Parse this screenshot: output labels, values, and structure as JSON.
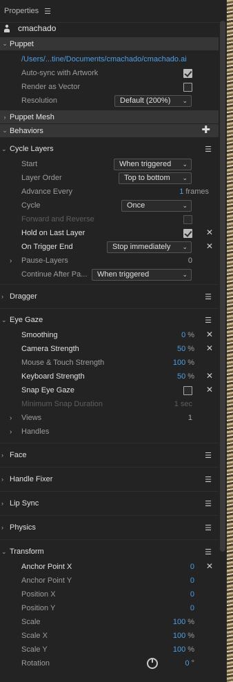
{
  "header": {
    "title": "Properties",
    "menu_icon": "hamburger-icon"
  },
  "puppet_name": "cmachado",
  "puppet_section": {
    "title": "Puppet",
    "file_path": "/Users/...tine/Documents/cmachado/cmachado.ai",
    "auto_sync_label": "Auto-sync with Artwork",
    "auto_sync_checked": true,
    "render_vector_label": "Render as Vector",
    "render_vector_checked": false,
    "resolution_label": "Resolution",
    "resolution_value": "Default (200%)"
  },
  "puppet_mesh_title": "Puppet Mesh",
  "behaviors_title": "Behaviors",
  "cycle_layers": {
    "title": "Cycle Layers",
    "start_label": "Start",
    "start_value": "When triggered",
    "layer_order_label": "Layer Order",
    "layer_order_value": "Top to bottom",
    "advance_label": "Advance Every",
    "advance_value": "1",
    "advance_unit": "frames",
    "cycle_label": "Cycle",
    "cycle_value": "Once",
    "forward_reverse_label": "Forward and Reverse",
    "hold_last_label": "Hold on Last Layer",
    "hold_last_checked": true,
    "trigger_end_label": "On Trigger End",
    "trigger_end_value": "Stop immediately",
    "pause_layers_label": "Pause-Layers",
    "pause_layers_value": "0",
    "continue_label": "Continue After Pa...",
    "continue_value": "When triggered"
  },
  "dragger_title": "Dragger",
  "eye_gaze": {
    "title": "Eye Gaze",
    "smoothing_label": "Smoothing",
    "smoothing_value": "0",
    "camera_label": "Camera Strength",
    "camera_value": "50",
    "mouse_label": "Mouse & Touch Strength",
    "mouse_value": "100",
    "keyboard_label": "Keyboard Strength",
    "keyboard_value": "50",
    "snap_label": "Snap Eye Gaze",
    "snap_checked": false,
    "min_snap_label": "Minimum Snap Duration",
    "min_snap_value": "1 sec",
    "views_label": "Views",
    "views_value": "1",
    "handles_label": "Handles",
    "percent": "%"
  },
  "face_title": "Face",
  "handle_fixer_title": "Handle Fixer",
  "lip_sync_title": "Lip Sync",
  "physics_title": "Physics",
  "transform": {
    "title": "Transform",
    "anchor_x_label": "Anchor Point X",
    "anchor_x_value": "0",
    "anchor_y_label": "Anchor Point Y",
    "anchor_y_value": "0",
    "pos_x_label": "Position X",
    "pos_x_value": "0",
    "pos_y_label": "Position Y",
    "pos_y_value": "0",
    "scale_label": "Scale",
    "scale_value": "100",
    "scale_x_label": "Scale X",
    "scale_x_value": "100",
    "scale_y_label": "Scale Y",
    "scale_y_value": "100",
    "rotation_label": "Rotation",
    "rotation_value": "0",
    "rotation_unit": "°",
    "percent": "%"
  },
  "colors": {
    "panel": "#232323",
    "section_bar": "#363636",
    "accent": "#4d9fe8"
  }
}
